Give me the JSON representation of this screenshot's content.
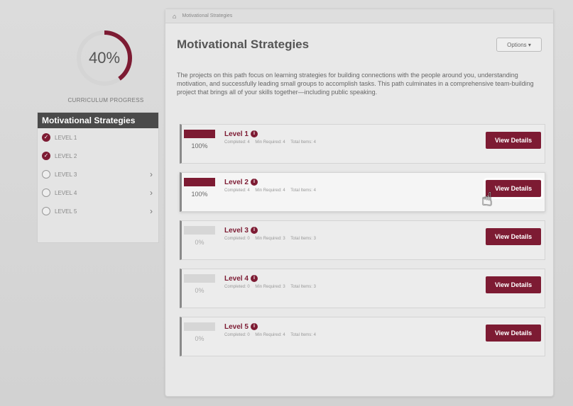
{
  "curriculum": {
    "progress_text": "40%",
    "progress_value": 40,
    "progress_label": "CURRICULUM PROGRESS"
  },
  "sidebar": {
    "title": "Motivational Strategies",
    "items": [
      {
        "label": "LEVEL 1",
        "status": "complete"
      },
      {
        "label": "LEVEL 2",
        "status": "complete"
      },
      {
        "label": "LEVEL 3",
        "status": "incomplete"
      },
      {
        "label": "LEVEL 4",
        "status": "incomplete"
      },
      {
        "label": "LEVEL 5",
        "status": "incomplete"
      }
    ]
  },
  "breadcrumb": {
    "label": "Motivational Strategies"
  },
  "main": {
    "title": "Motivational Strategies",
    "options_label": "Options ▾",
    "description": "The projects on this path focus on learning strategies for building connections with the people around you, understanding motivation, and successfully leading small groups to accomplish tasks. This path culminates in a comprehensive team-building project that brings all of your skills together—including public speaking.",
    "levels": [
      {
        "title": "Level 1",
        "percent": "100%",
        "completed": "Completed: 4",
        "min_required": "Min Required: 4",
        "total_items": "Total Items: 4",
        "button": "View Details"
      },
      {
        "title": "Level 2",
        "percent": "100%",
        "completed": "Completed: 4",
        "min_required": "Min Required: 4",
        "total_items": "Total Items: 4",
        "button": "View Details"
      },
      {
        "title": "Level 3",
        "percent": "0%",
        "completed": "Completed: 0",
        "min_required": "Min Required: 3",
        "total_items": "Total Items: 3",
        "button": "View Details"
      },
      {
        "title": "Level 4",
        "percent": "0%",
        "completed": "Completed: 0",
        "min_required": "Min Required: 3",
        "total_items": "Total Items: 3",
        "button": "View Details"
      },
      {
        "title": "Level 5",
        "percent": "0%",
        "completed": "Completed: 0",
        "min_required": "Min Required: 4",
        "total_items": "Total Items: 4",
        "button": "View Details"
      }
    ]
  },
  "icons": {
    "home": "home-icon",
    "check": "check-circle-icon",
    "circle": "empty-circle-icon",
    "chevron": "chevron-right-icon",
    "info": "info-icon",
    "cursor": "hand-pointer-icon"
  },
  "colors": {
    "accent": "#7d1b33",
    "sidebar_header": "#4a4a4a",
    "panel_bg": "#e8e8e8"
  }
}
